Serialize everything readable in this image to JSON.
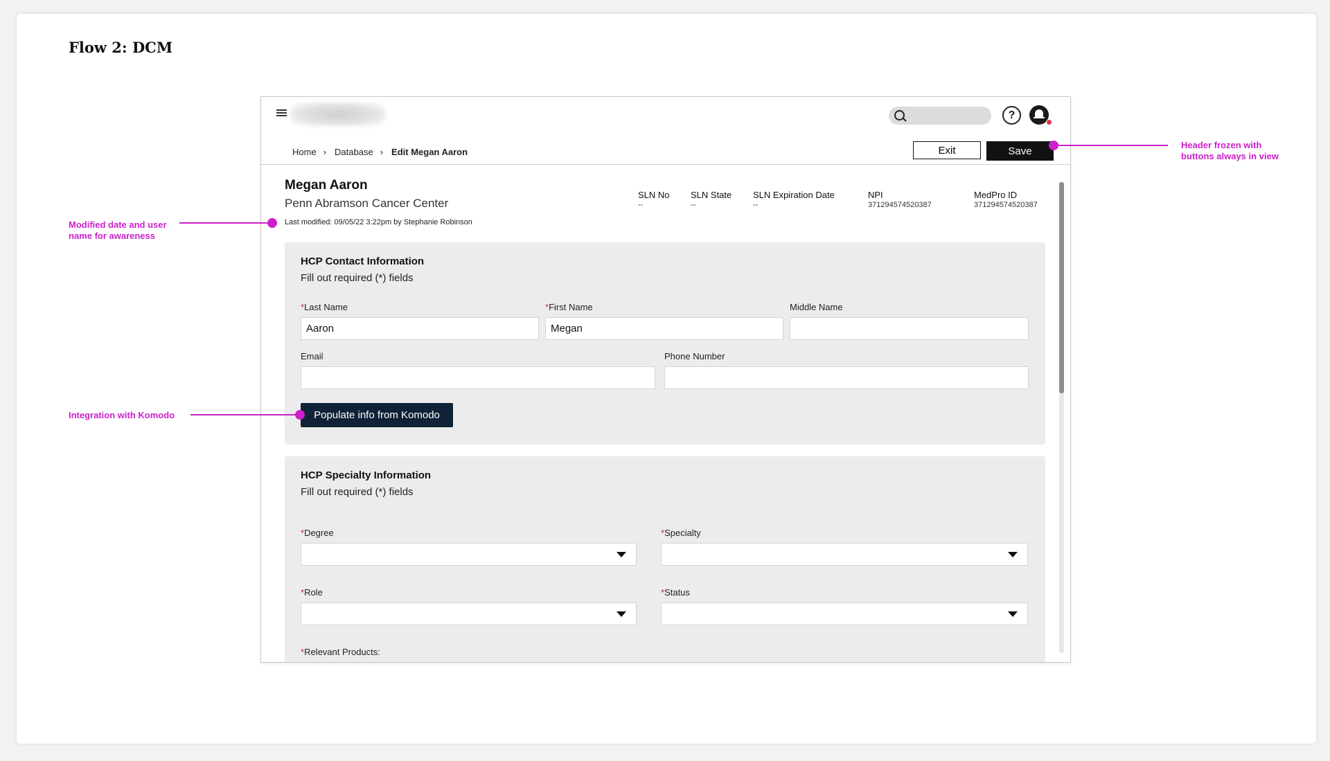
{
  "page_title": "Flow 2: DCM",
  "app": {
    "breadcrumb": [
      "Home",
      "Database",
      "Edit Megan Aaron"
    ],
    "buttons": {
      "exit": "Exit",
      "save": "Save"
    },
    "help_glyph": "?"
  },
  "profile": {
    "name": "Megan Aaron",
    "organization": "Penn Abramson Cancer Center",
    "last_modified": "Last modified: 09/05/22 3:22pm by Stephanie Robinson",
    "fields": [
      {
        "label": "SLN No",
        "value": "--"
      },
      {
        "label": "SLN State",
        "value": "--"
      },
      {
        "label": "SLN Expiration Date",
        "value": "--"
      },
      {
        "label": "NPI",
        "value": "371294574520387"
      },
      {
        "label": "MedPro ID",
        "value": "371294574520387"
      }
    ]
  },
  "contact_section": {
    "title": "HCP Contact Information",
    "subtitle": "Fill out required (*) fields",
    "required_mark": "*",
    "last_name_label": "Last Name",
    "last_name_value": "Aaron",
    "first_name_label": "First Name",
    "first_name_value": "Megan",
    "middle_name_label": "Middle Name",
    "middle_name_value": "",
    "email_label": "Email",
    "email_value": "",
    "phone_label": "Phone Number",
    "phone_value": "",
    "komodo_button": "Populate info from Komodo"
  },
  "specialty_section": {
    "title": "HCP Specialty Information",
    "subtitle": "Fill out required (*) fields",
    "degree_label": "Degree",
    "specialty_label": "Specialty",
    "role_label": "Role",
    "status_label": "Status",
    "products_label": "Relevant Products:"
  },
  "annotations": {
    "modified": "Modified date and user name for awareness",
    "modified_l1": "Modified date and user",
    "modified_l2": "name for awareness",
    "komodo": "Integration with Komodo",
    "header_l1": "Header frozen with",
    "header_l2": "buttons always in view",
    "color": "#cc1fcc"
  },
  "icons": [
    "hamburger-icon",
    "search-icon",
    "help-icon",
    "bell-icon",
    "chevron-right-icon",
    "caret-down-icon"
  ]
}
